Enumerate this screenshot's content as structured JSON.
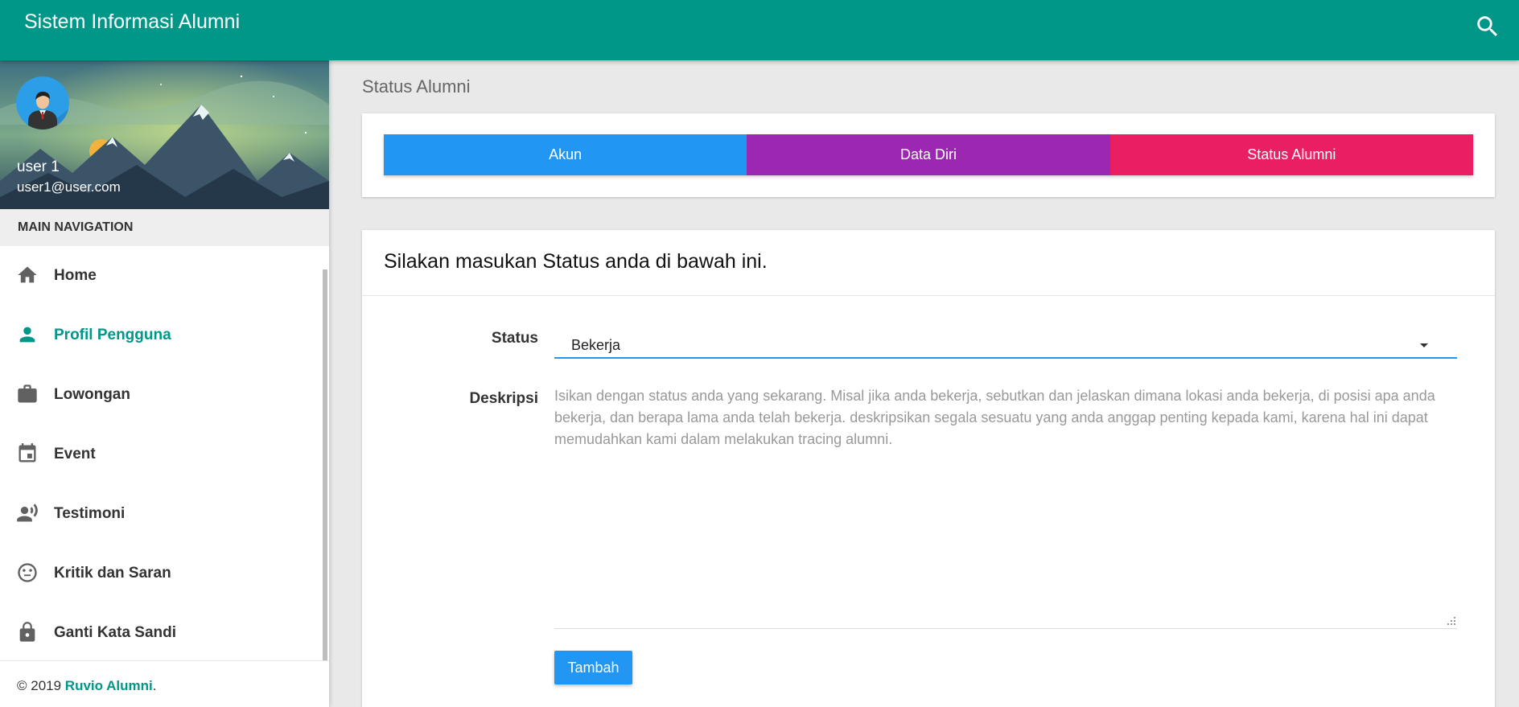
{
  "app": {
    "title": "Sistem Informasi Alumni"
  },
  "header": {
    "search_icon": "search-icon"
  },
  "user": {
    "name": "user 1",
    "email": "user1@user.com"
  },
  "sidebar": {
    "header": "MAIN NAVIGATION",
    "items": [
      {
        "label": "Home",
        "icon": "home-icon",
        "active": false
      },
      {
        "label": "Profil Pengguna",
        "icon": "person-icon",
        "active": true
      },
      {
        "label": "Lowongan",
        "icon": "briefcase-icon",
        "active": false
      },
      {
        "label": "Event",
        "icon": "calendar-icon",
        "active": false
      },
      {
        "label": "Testimoni",
        "icon": "record-voice-icon",
        "active": false
      },
      {
        "label": "Kritik dan Saran",
        "icon": "neutral-face-icon",
        "active": false
      },
      {
        "label": "Ganti Kata Sandi",
        "icon": "lock-icon",
        "active": false
      }
    ],
    "footer": {
      "copyright": "© 2019 ",
      "brand": "Ruvio Alumni",
      "suffix": "."
    }
  },
  "page": {
    "title": "Status Alumni"
  },
  "tabs": [
    {
      "label": "Akun",
      "color": "#2196f3"
    },
    {
      "label": "Data Diri",
      "color": "#9c27b0"
    },
    {
      "label": "Status Alumni",
      "color": "#e91e63"
    }
  ],
  "form": {
    "heading": "Silakan masukan Status anda di bawah ini.",
    "status_label": "Status",
    "status_value": "Bekerja",
    "description_label": "Deskripsi",
    "description_placeholder": "Isikan dengan status anda yang sekarang. Misal jika anda bekerja, sebutkan dan jelaskan dimana lokasi anda bekerja, di posisi apa anda bekerja, dan berapa lama anda telah bekerja. deskripsikan segala sesuatu yang anda anggap penting kepada kami, karena hal ini dapat memudahkan kami dalam melakukan tracing alumni.",
    "submit_label": "Tambah"
  },
  "colors": {
    "primary": "#009688",
    "accent": "#2196f3"
  }
}
